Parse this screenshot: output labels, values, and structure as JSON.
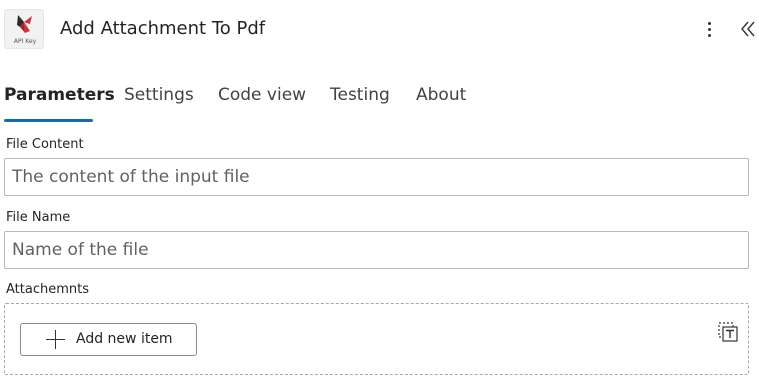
{
  "header": {
    "title": "Add Attachment To Pdf",
    "icon_caption": "API Key",
    "icon_name": "api-key-connector-icon",
    "brand_color": "#d13438"
  },
  "tabs": [
    {
      "label": "Parameters",
      "active": true
    },
    {
      "label": "Settings",
      "active": false
    },
    {
      "label": "Code view",
      "active": false
    },
    {
      "label": "Testing",
      "active": false
    },
    {
      "label": "About",
      "active": false
    }
  ],
  "fields": {
    "file_content": {
      "label": "File Content",
      "placeholder": "The content of the input file",
      "value": ""
    },
    "file_name": {
      "label": "File Name",
      "placeholder": "Name of the file",
      "value": ""
    },
    "attachments": {
      "label": "Attachemnts",
      "add_button_label": "Add new item"
    }
  },
  "colors": {
    "accent": "#0f6cbd",
    "text": "#242424"
  }
}
